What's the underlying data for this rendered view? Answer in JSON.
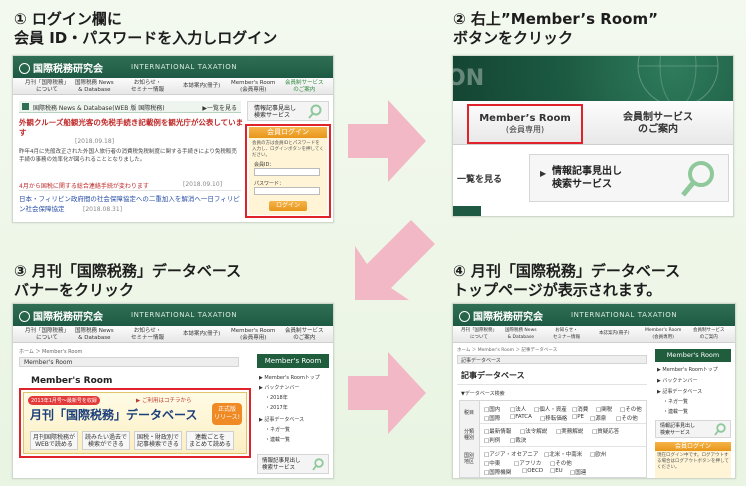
{
  "steps": {
    "s1": "① ログイン欄に\n会員 ID・パスワードを入力しログイン",
    "s2": "② 右上”Member’s Room”\nボタンをクリック",
    "s3": "③ 月刊「国際税務」データベース\nバナーをクリック",
    "s4": "④ 月刊「国際税務」データベース\nトップページが表示されます。"
  },
  "site": {
    "logo": "国際税務研究会",
    "logo_sub": "INTERNATIONAL TAXATION",
    "nav": [
      "月刊「国際税務」\nについて",
      "国際税務 News\n& Database",
      "お知らせ・\nセミナー情報",
      "本誌案内(冊子)",
      "Member's Room\n(会員専用)",
      "会員制サービス\nのご案内"
    ]
  },
  "shot1": {
    "section_title": "国際税務 News & Database(WEB 版 国際税務)",
    "list_link": "▶一覧を見る",
    "headline": "外観クルーズ船観光客の免税手続き記載例を観光庁が公表しています",
    "date1": "[2018.09.18]",
    "body": "昨年4月に先般改正された外国人旅行者の消費税免税制度に関する手続きにより免税販売手続の事務の効率化が図られることとなりました。",
    "link2": "4月から国税に関する総合連絡手続が変わります",
    "date2": "[2018.09.10]",
    "link3": "日本・フィリピン政府間の社会保障協定への二重加入を解消へ一日フィリピン社会保障協定",
    "date3": "[2018.08.31]",
    "side_service": "情報記事見出し\n検索サービス",
    "login_title": "会員ログイン",
    "login_desc": "会員の方は会員IDとパスワードを入力し、ログインボタンを押してください。",
    "id_label": "会員ID：",
    "pw_label": "パスワード：",
    "login_btn": "ログイン"
  },
  "shot2": {
    "member_room": "Member’s Room",
    "member_room_sub": "(会員専用)",
    "service": "会員制サービス\nのご案内",
    "see_list": "一覧を見る",
    "search_service": "情報記事見出し\n検索サービス"
  },
  "shot3": {
    "breadcrumb": "ホーム ＞ Member's Room",
    "room_bar": "Member's Room",
    "heading": "Member's Room",
    "banner_tag": "2013年1月号～最新号を収録",
    "banner_click": "▶ ご利用はコチラから",
    "banner_title": "月刊「国際税務」データベース",
    "banner_badge": "正式版\nリリース!",
    "pills": [
      "月刊国際税務が\nWEBで読める",
      "読みたい過去で\n検索ができる",
      "国税・財政別で\n記事検索できる",
      "連載ごとを\nまとめて読める"
    ],
    "side_title": "Member's Room",
    "side_items": [
      "▶ Member's Roomトップ",
      "▶ バックナンバー",
      "・2018年",
      "・2017年",
      "▶ 記事データベース",
      "・ネガ一覧",
      "・連載一覧"
    ],
    "side_service": "情報記事見出し\n検索サービス"
  },
  "shot4": {
    "breadcrumb": "ホーム ＞ Member's Room ＞ 記事データベース",
    "title_bar": "記事データベース",
    "heading": "記事データベース",
    "search_label": "▼データベース検索",
    "row_labels": [
      "税目",
      "分類\n種別",
      "国別\n地区"
    ],
    "row1": [
      "□国内",
      "□法人",
      "□個人・資産",
      "□消費",
      "□関税",
      "□その他"
    ],
    "row2": [
      "□国際",
      "□FATCA",
      "□移転価格",
      "□PE",
      "□源泉",
      "□その他"
    ],
    "row3": [
      "□最新情報",
      "□法令解説",
      "□実務解説",
      "□質疑応答"
    ],
    "row4": [
      "□判例",
      "□裁決"
    ],
    "row5": [
      "□アジア・オセアニア",
      "□北米・中南米",
      "□欧州"
    ],
    "row6": [
      "□中東",
      "□アフリカ",
      "□その他"
    ],
    "row7": [
      "□国際機関",
      "□OECD",
      "□EU",
      "□国連"
    ],
    "side_title": "Member's Room",
    "side_items": [
      "▶ Member's Roomトップ",
      "▶ バックナンバー",
      "▶ 記事データベース",
      "・ネガ一覧",
      "・連載一覧"
    ],
    "side_service": "情報記事見出し\n検索サービス",
    "login_title": "会員ログイン",
    "login_desc": "現在ログイン中です。ログアウトする場合はログアウトボタンを押してください。"
  },
  "colors": {
    "brand_green": "#1e5a43",
    "highlight_red": "#e0232a",
    "arrow_pink": "#f2b8c6",
    "login_orange": "#e8961a"
  }
}
